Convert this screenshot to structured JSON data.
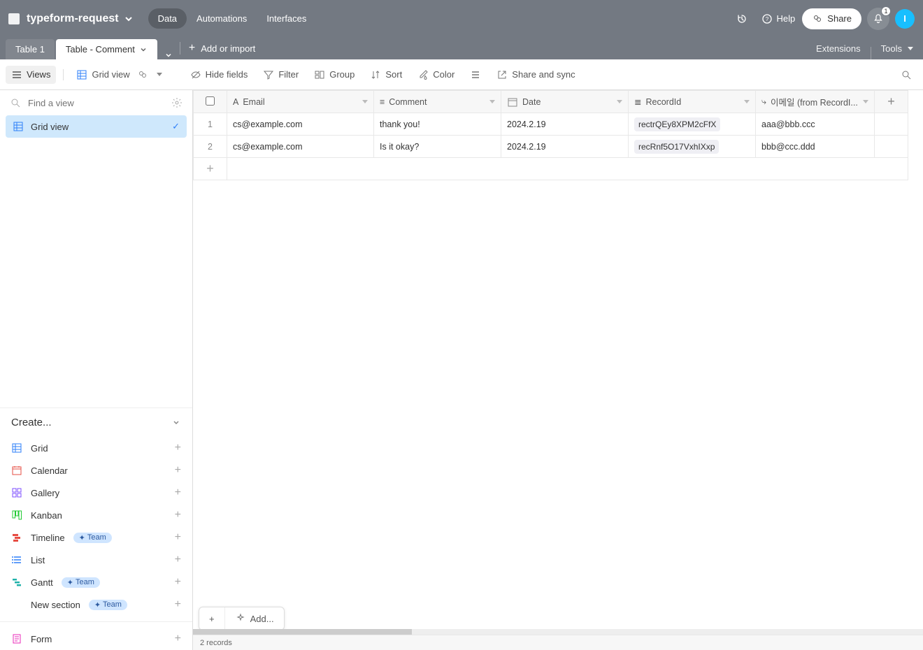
{
  "header": {
    "base_name": "typeform-request",
    "nav": {
      "data": "Data",
      "automations": "Automations",
      "interfaces": "Interfaces"
    },
    "help": "Help",
    "share": "Share",
    "notif_count": "1",
    "avatar_initial": "I"
  },
  "tabs": {
    "tab1": "Table 1",
    "tab2": "Table - Comment",
    "add_or_import": "Add or import",
    "extensions": "Extensions",
    "tools": "Tools"
  },
  "toolbar": {
    "views": "Views",
    "grid_view": "Grid view",
    "hide_fields": "Hide fields",
    "filter": "Filter",
    "group": "Group",
    "sort": "Sort",
    "color": "Color",
    "share_sync": "Share and sync"
  },
  "sidebar": {
    "find_placeholder": "Find a view",
    "selected_view": "Grid view",
    "create_label": "Create...",
    "items": [
      {
        "label": "Grid",
        "color": "#2d7ff9"
      },
      {
        "label": "Calendar",
        "color": "#e64d43"
      },
      {
        "label": "Gallery",
        "color": "#7c4dff"
      },
      {
        "label": "Kanban",
        "color": "#20c933"
      },
      {
        "label": "Timeline",
        "color": "#e64d43",
        "team": true
      },
      {
        "label": "List",
        "color": "#2d7ff9"
      },
      {
        "label": "Gantt",
        "color": "#20b2aa",
        "team": true
      }
    ],
    "new_section": "New section",
    "team_label": "Team",
    "form_label": "Form"
  },
  "grid": {
    "columns": {
      "email": "Email",
      "comment": "Comment",
      "date": "Date",
      "recordid": "RecordId",
      "lookup": "이메일 (from RecordI..."
    },
    "rows": [
      {
        "num": "1",
        "email": "cs@example.com",
        "comment": "thank you!",
        "date": "2024.2.19",
        "recordid": "rectrQEy8XPM2cFfX",
        "lookup": "aaa@bbb.ccc"
      },
      {
        "num": "2",
        "email": "cs@example.com",
        "comment": "Is it okay?",
        "date": "2024.2.19",
        "recordid": "recRnf5O17VxhIXxp",
        "lookup": "bbb@ccc.ddd"
      }
    ],
    "add_label": "Add...",
    "records_count": "2 records"
  }
}
